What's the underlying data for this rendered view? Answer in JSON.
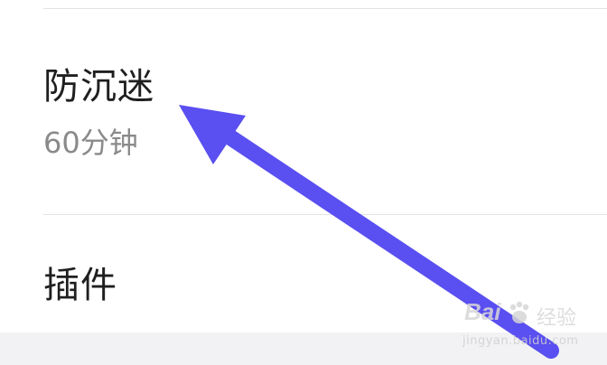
{
  "settings": {
    "anti_addiction": {
      "title": "防沉迷",
      "value": "60分钟"
    },
    "plugins": {
      "title": "插件"
    }
  },
  "watermark": {
    "brand": "Bai",
    "brand_suffix": "经验",
    "url": "jingyan.baidu.com",
    "icon": "baidu-paw-icon"
  },
  "annotation": {
    "icon": "arrow-icon",
    "color": "#5a4ff0"
  }
}
